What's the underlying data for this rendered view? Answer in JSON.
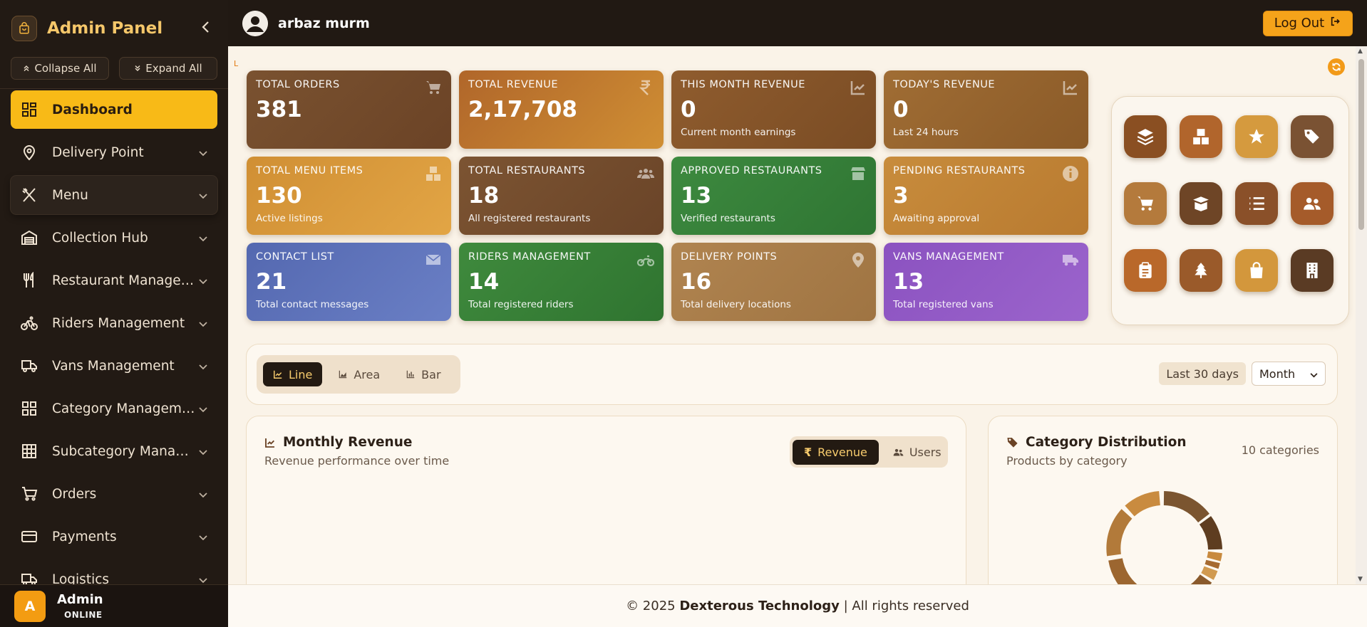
{
  "sidebar": {
    "title": "Admin Panel",
    "collapse_all": "Collapse All",
    "expand_all": "Expand All",
    "items": [
      {
        "label": "Dashboard",
        "icon": "grid-icon"
      },
      {
        "label": "Delivery Point",
        "icon": "map-pin-icon"
      },
      {
        "label": "Menu",
        "icon": "utensils-icon"
      },
      {
        "label": "Collection Hub",
        "icon": "warehouse-icon"
      },
      {
        "label": "Restaurant Management",
        "icon": "fork-knife-icon"
      },
      {
        "label": "Riders Management",
        "icon": "bicycle-icon"
      },
      {
        "label": "Vans Management",
        "icon": "truck-icon"
      },
      {
        "label": "Category Management",
        "icon": "grid-icon"
      },
      {
        "label": "Subcategory Management",
        "icon": "table-icon"
      },
      {
        "label": "Orders",
        "icon": "cart-icon"
      },
      {
        "label": "Payments",
        "icon": "credit-card-icon"
      },
      {
        "label": "Logistics",
        "icon": "truck-icon"
      }
    ],
    "user": {
      "avatar_letter": "A",
      "name": "Admin",
      "status": "ONLINE"
    }
  },
  "topbar": {
    "username": "arbaz murm",
    "logout": "Log Out"
  },
  "stats": [
    {
      "title": "TOTAL ORDERS",
      "value": "381",
      "sub": "",
      "icon": "cart-icon",
      "bg": "#7a5230"
    },
    {
      "title": "TOTAL REVENUE",
      "value": "2,17,708",
      "sub": "",
      "icon": "rupee-icon",
      "bg": "#b8722a"
    },
    {
      "title": "THIS MONTH REVENUE",
      "value": "0",
      "sub": "Current month earnings",
      "icon": "chart-line-icon",
      "bg": "#8f5c2e"
    },
    {
      "title": "TODAY'S REVENUE",
      "value": "0",
      "sub": "Last 24 hours",
      "icon": "chart-line-icon",
      "bg": "#a06d34"
    },
    {
      "title": "TOTAL MENU ITEMS",
      "value": "130",
      "sub": "Active listings",
      "icon": "boxes-icon",
      "bg": "#d08f34"
    },
    {
      "title": "TOTAL RESTAURANTS",
      "value": "18",
      "sub": "All registered restaurants",
      "icon": "users-icon",
      "bg": "#7c5432"
    },
    {
      "title": "APPROVED RESTAURANTS",
      "value": "13",
      "sub": "Verified restaurants",
      "icon": "store-icon",
      "bg": "#3d8a3f"
    },
    {
      "title": "PENDING RESTAURANTS",
      "value": "3",
      "sub": "Awaiting approval",
      "icon": "info-icon",
      "bg": "#c88c3c"
    },
    {
      "title": "CONTACT LIST",
      "value": "21",
      "sub": "Total contact messages",
      "icon": "envelope-icon",
      "bg": "#5a6fb8"
    },
    {
      "title": "RIDERS MANAGEMENT",
      "value": "14",
      "sub": "Total registered riders",
      "icon": "motorcycle-icon",
      "bg": "#3f8a3d"
    },
    {
      "title": "DELIVERY POINTS",
      "value": "16",
      "sub": "Total delivery locations",
      "icon": "map-pin-icon",
      "bg": "#b08450"
    },
    {
      "title": "VANS MANAGEMENT",
      "value": "13",
      "sub": "Total registered vans",
      "icon": "truck-icon",
      "bg": "#8b52c0"
    }
  ],
  "quick_actions": [
    {
      "icon": "layers-icon",
      "bg": "#8a4f22"
    },
    {
      "icon": "boxes-icon",
      "bg": "#b1652c"
    },
    {
      "icon": "star-icon",
      "bg": "#d59a3e"
    },
    {
      "icon": "tags-icon",
      "bg": "#7a5233"
    },
    {
      "icon": "cart-icon",
      "bg": "#b47a3c"
    },
    {
      "icon": "box-open-icon",
      "bg": "#6e4526"
    },
    {
      "icon": "list-icon",
      "bg": "#8a5029"
    },
    {
      "icon": "users-icon",
      "bg": "#a55b2a"
    },
    {
      "icon": "clipboard-icon",
      "bg": "#b9682a"
    },
    {
      "icon": "tree-icon",
      "bg": "#9a5a2a"
    },
    {
      "icon": "shopping-bag-icon",
      "bg": "#d3973c"
    },
    {
      "icon": "building-icon",
      "bg": "#5a3b24"
    }
  ],
  "controls": {
    "chart_types": [
      "Line",
      "Area",
      "Bar"
    ],
    "active_type": "Line",
    "range_label": "Last 30 days",
    "period": "Month"
  },
  "revenue_panel": {
    "title": "Monthly Revenue",
    "subtitle": "Revenue performance over time",
    "toggle": [
      "Revenue",
      "Users"
    ]
  },
  "category_panel": {
    "title": "Category Distribution",
    "subtitle": "Products by category",
    "count": "10 categories"
  },
  "footer": {
    "prefix": "© 2025 ",
    "brand": "Dexterous Technology",
    "suffix": " | All rights reserved"
  },
  "colors": {
    "accent": "#f8ba17",
    "sidebar": "#221a14",
    "topbar": "#211913",
    "page_bg": "#faf3e8"
  }
}
